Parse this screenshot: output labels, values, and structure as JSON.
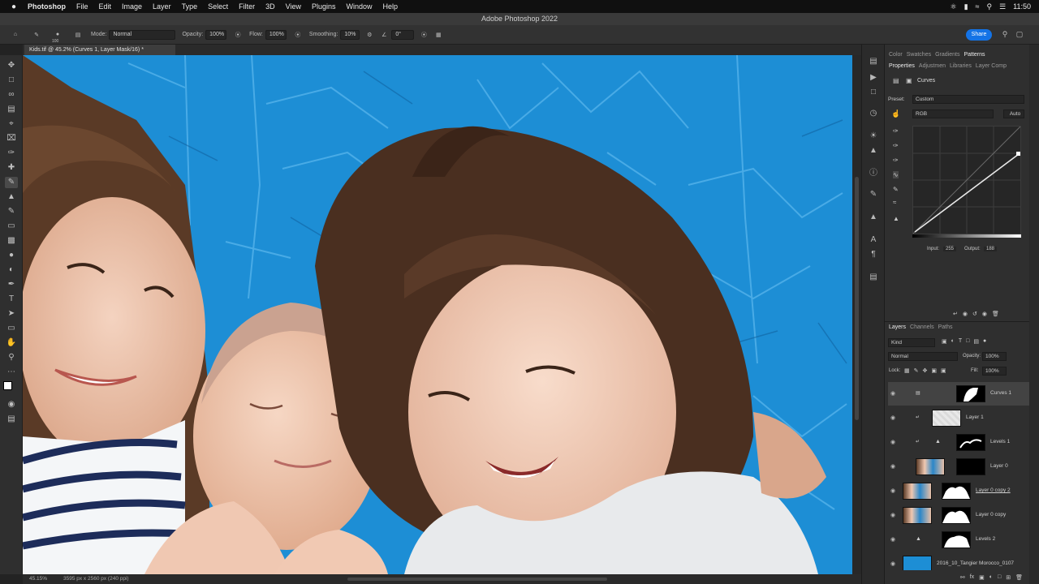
{
  "menubar": {
    "apple": "",
    "app": "Photoshop",
    "items": [
      "File",
      "Edit",
      "Image",
      "Layer",
      "Type",
      "Select",
      "Filter",
      "3D",
      "View",
      "Plugins",
      "Window",
      "Help"
    ],
    "time": "11:50"
  },
  "titlebar": {
    "title": "Adobe Photoshop 2022"
  },
  "options": {
    "mode_label": "Mode:",
    "mode": "Normal",
    "opacity_label": "Opacity:",
    "opacity": "100%",
    "flow_label": "Flow:",
    "flow": "100%",
    "smoothing_label": "Smoothing:",
    "smoothing": "10%",
    "angle": "0°",
    "brush_size": "100",
    "share": "Share"
  },
  "document": {
    "tab": "Kids.tif @ 45.2% (Curves 1, Layer Mask/16) *"
  },
  "status": {
    "zoom": "45.15%",
    "dims": "3595 px x 2560 px (240 ppi)"
  },
  "panel_tabs_top": [
    "Color",
    "Swatches",
    "Gradients",
    "Patterns"
  ],
  "panel_tabs_props": [
    "Properties",
    "Adjustmen",
    "Libraries",
    "Layer Comp"
  ],
  "properties": {
    "title": "Curves",
    "preset_label": "Preset:",
    "preset": "Custom",
    "channel": "RGB",
    "auto": "Auto",
    "input_label": "Input:",
    "input": "255",
    "output_label": "Output:",
    "output": "188"
  },
  "layers_tabs": [
    "Layers",
    "Channels",
    "Paths"
  ],
  "layers_panel": {
    "kind": "Kind",
    "blend": "Normal",
    "opacity_label": "Opacity:",
    "opacity": "100%",
    "lock_label": "Lock:",
    "fill_label": "Fill:",
    "fill": "100%"
  },
  "layers": [
    {
      "name": "Curves 1"
    },
    {
      "name": "Layer 1"
    },
    {
      "name": "Levels 1"
    },
    {
      "name": "Layer 0"
    },
    {
      "name": "Layer 0 copy 2"
    },
    {
      "name": "Layer 0 copy"
    },
    {
      "name": "Levels 2"
    },
    {
      "name": "2016_10_Tangier Morocco_0107"
    }
  ],
  "colors": {
    "canvas_bg": "#1e8fd6",
    "accent": "#1473e6"
  }
}
